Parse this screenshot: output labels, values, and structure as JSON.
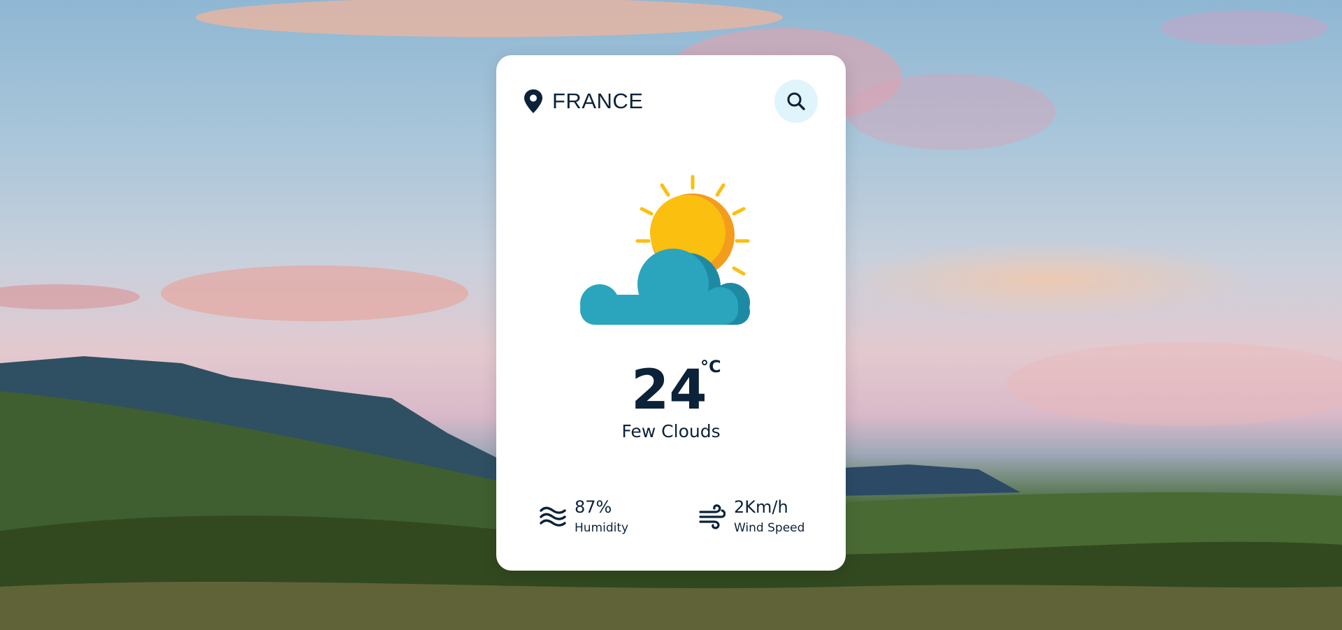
{
  "location": {
    "name": "FRANCE",
    "icon": "map-pin-icon"
  },
  "search": {
    "icon": "search-icon"
  },
  "weather": {
    "icon": "sun-behind-cloud-icon",
    "temperature": "24",
    "unit": "°C",
    "condition": "Few Clouds"
  },
  "stats": {
    "humidity": {
      "value": "87%",
      "label": "Humidity",
      "icon": "humidity-waves-icon"
    },
    "wind": {
      "value": "2Km/h",
      "label": "Wind Speed",
      "icon": "wind-icon"
    }
  },
  "colors": {
    "text": "#0b2238",
    "card": "#ffffff",
    "search_bg": "#e0f4fc",
    "sun": "#fbbf0f",
    "sun_shade": "#f39c1e",
    "cloud": "#2aa5bd",
    "cloud_shade": "#1d8aa4"
  }
}
